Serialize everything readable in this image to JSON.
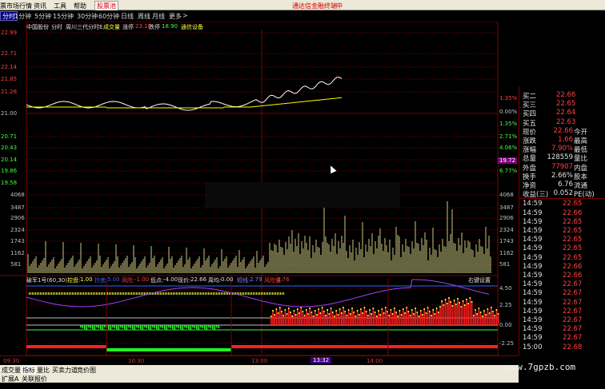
{
  "menubar": {
    "items": [
      "票市场行情",
      "资讯",
      "工具",
      "帮助"
    ],
    "sign": "股票池",
    "right_link": "通达信金融终端",
    "right_edge": "中"
  },
  "toolbar": {
    "periods": [
      "分时",
      "1分钟",
      "5分钟",
      "15分钟",
      "30分钟",
      "60分钟",
      "日线",
      "周线",
      "月线",
      "更多",
      ">"
    ]
  },
  "header": {
    "stock": "中国股份",
    "fenshi": "分时",
    "indicator": "周川三代分时E",
    "vol_label": "成交量",
    "zhangting_label": "涨停",
    "zhangting_val": "23.10",
    "dieting_label": "跌停",
    "dieting_val": "18.90",
    "extra": "通信设备"
  },
  "price_axis": {
    "left": [
      "22.99",
      "22.71",
      "22.14",
      "21.85",
      "21.28",
      "21.00",
      "20.71",
      "20.43",
      "20.14",
      "19.86",
      "19.58"
    ],
    "right_pct": [
      "1.35%",
      "0.00%",
      "1.35%",
      "2.71%",
      "4.06%",
      "5.41%",
      "6.77%"
    ],
    "current": "19.72"
  },
  "volume_axis": {
    "left": [
      "4068",
      "3487",
      "2906",
      "2324",
      "1743",
      "1162",
      "581"
    ],
    "right": [
      "4068",
      "3487",
      "2906",
      "2324",
      "1743",
      "1162",
      "581"
    ]
  },
  "indicator_bar": {
    "name": "破军1号(60,30)",
    "items": [
      {
        "label": "控盘:",
        "val": "1.00",
        "color": "#ffff40"
      },
      {
        "label": "抄底:",
        "val": "5.00",
        "color": "#4060ff"
      },
      {
        "label": "风险:",
        "val": "-1.00",
        "color": "#ff4040"
      },
      {
        "label": "低点:",
        "val": "-4.00",
        "color": "#e0e0e0"
      },
      {
        "label": "现价:",
        "val": "22.66",
        "color": "#e0e0e0"
      },
      {
        "label": "周均:",
        "val": "0.00",
        "color": "#e0e0e0"
      },
      {
        "label": "短线:",
        "val": "2.79",
        "color": "#8080ff"
      },
      {
        "label": "风险值:",
        "val": "2.76",
        "color": "#ff4040"
      }
    ],
    "settings": "右键设置",
    "axis": [
      "4.50",
      "2.25",
      "0.00",
      "-2.25"
    ]
  },
  "time_axis": [
    "09:30",
    "10:30",
    "13:00",
    "13:32",
    "14:00"
  ],
  "quote": {
    "buy": [
      {
        "label": "买二",
        "price": "22.66"
      },
      {
        "label": "买三",
        "price": "22.65"
      },
      {
        "label": "买四",
        "price": "22.64"
      },
      {
        "label": "买五",
        "price": "22.63"
      }
    ],
    "stats": [
      {
        "label": "现价",
        "val": "22.66",
        "label2": "今开",
        "color": "red"
      },
      {
        "label": "涨跌",
        "val": "1.66",
        "label2": "最高",
        "color": "red"
      },
      {
        "label": "涨幅",
        "val": "7.90%",
        "label2": "最低",
        "color": "red"
      },
      {
        "label": "总量",
        "val": "128559",
        "label2": "量比",
        "color": "white"
      },
      {
        "label": "外盘",
        "val": "77907",
        "label2": "内盘",
        "color": "red"
      },
      {
        "label": "换手",
        "val": "2.66%",
        "label2": "股本",
        "color": "white"
      },
      {
        "label": "净资",
        "val": "6.76",
        "label2": "流通",
        "color": "white"
      },
      {
        "label": "收益(三)",
        "val": "0.052",
        "label2": "PE(动)",
        "color": "white"
      }
    ],
    "ticks": [
      {
        "time": "14:59",
        "price": "22.65"
      },
      {
        "time": "14:59",
        "price": "22.66"
      },
      {
        "time": "14:59",
        "price": "22.65"
      },
      {
        "time": "14:59",
        "price": "22.65"
      },
      {
        "time": "14:59",
        "price": "22.65"
      },
      {
        "time": "14:59",
        "price": "22.65"
      },
      {
        "time": "14:59",
        "price": "22.65"
      },
      {
        "time": "14:59",
        "price": "22.66"
      },
      {
        "time": "14:59",
        "price": "22.66"
      },
      {
        "time": "14:59",
        "price": "22.67"
      },
      {
        "time": "14:59",
        "price": "22.67"
      },
      {
        "time": "14:59",
        "price": "22.67"
      },
      {
        "time": "14:59",
        "price": "22.67"
      },
      {
        "time": "14:59",
        "price": "22.67"
      },
      {
        "time": "14:59",
        "price": "22.67"
      },
      {
        "time": "14:59",
        "price": "22.67"
      },
      {
        "time": "15:00",
        "price": "22.68"
      }
    ]
  },
  "tabs1": [
    "成交量",
    "指标",
    "量比",
    "买卖力道",
    "竞价图"
  ],
  "tabs2": [
    "扩展A",
    "关联报价"
  ],
  "watermark": "www.7gpzb.com",
  "colors": {
    "grid": "#800000",
    "price_line": "#ffffff",
    "avg_line": "#ffff00",
    "volume": "#c8c880",
    "up": "#ff2020",
    "down": "#20ff20"
  }
}
